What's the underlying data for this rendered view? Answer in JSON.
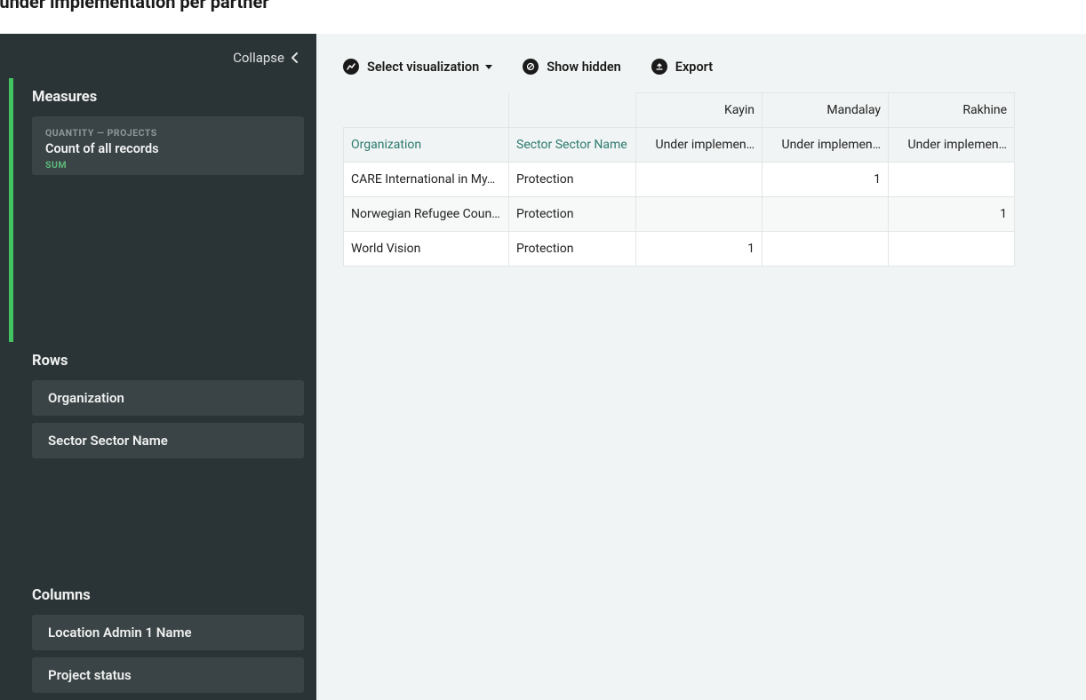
{
  "page": {
    "title": "Project under implementation per partner"
  },
  "sidebar": {
    "collapse_label": "Collapse",
    "measures": {
      "title": "Measures",
      "item": {
        "meta": "QUANTITY — PROJECTS",
        "main": "Count of all records",
        "sub": "SUM"
      }
    },
    "rows": {
      "title": "Rows",
      "items": [
        "Organization",
        "Sector Sector Name"
      ]
    },
    "columns": {
      "title": "Columns",
      "items": [
        "Location Admin 1 Name",
        "Project status"
      ]
    }
  },
  "toolbar": {
    "select_viz": "Select visualization",
    "show_hidden": "Show hidden",
    "export": "Export"
  },
  "table": {
    "row_headers": [
      "Organization",
      "Sector Sector Name"
    ],
    "col_groups": [
      "Kayin",
      "Mandalay",
      "Rakhine"
    ],
    "value_header": "Under implemen…",
    "rows": [
      {
        "org": "CARE International in My…",
        "sector": "Protection",
        "vals": [
          "",
          "1",
          ""
        ]
      },
      {
        "org": "Norwegian Refugee Coun…",
        "sector": "Protection",
        "vals": [
          "",
          "",
          "1"
        ]
      },
      {
        "org": "World Vision",
        "sector": "Protection",
        "vals": [
          "1",
          "",
          ""
        ]
      }
    ]
  }
}
